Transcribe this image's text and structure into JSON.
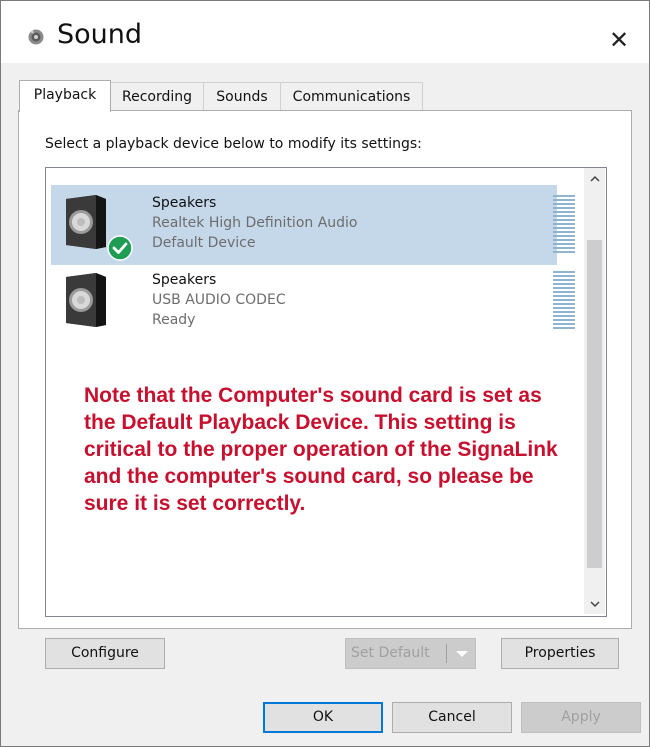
{
  "window": {
    "title": "Sound",
    "close_glyph": "✕"
  },
  "tabs": [
    {
      "label": "Playback",
      "active": true
    },
    {
      "label": "Recording",
      "active": false
    },
    {
      "label": "Sounds",
      "active": false
    },
    {
      "label": "Communications",
      "active": false
    }
  ],
  "panel": {
    "instruction": "Select a playback device below to modify its settings:"
  },
  "devices": [
    {
      "name": "Speakers",
      "driver": "Realtek High Definition Audio",
      "status": "Default Device",
      "selected": true,
      "default_badge": "check-icon"
    },
    {
      "name": "Speakers",
      "driver": "USB AUDIO  CODEC",
      "status": "Ready",
      "selected": false
    }
  ],
  "note": {
    "text": "Note that the Computer's sound card is set as the Default Playback Device. This setting is critical to the proper operation of the SignaLink and the computer's sound card, so please be sure it is set correctly.",
    "color": "#c8102e"
  },
  "scrollbar": {
    "up_glyph": "^",
    "down_glyph": "v"
  },
  "buttons": {
    "configure": "Configure",
    "set_default": "Set Default",
    "properties": "Properties",
    "ok": "OK",
    "cancel": "Cancel",
    "apply": "Apply"
  },
  "colors": {
    "selection": "#c4d8ea",
    "accent": "#0078d7",
    "default_badge": "#1f9d55"
  }
}
